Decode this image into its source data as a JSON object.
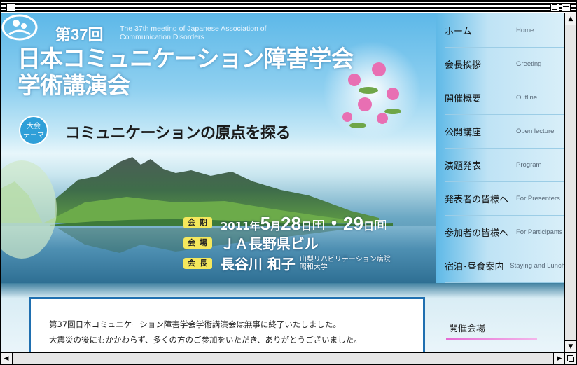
{
  "hero": {
    "meeting_number": "第37回",
    "subtitle_line1": "The 37th meeting of Japanese Association of",
    "subtitle_line2": "Communication Disorders",
    "title_line1": "日本コミュニケーション障害学会",
    "title_line2": "学術講演会",
    "theme_badge_line1": "大会",
    "theme_badge_line2": "テーマ",
    "theme": "コミュニケーションの原点を探る",
    "date_label": "会 期",
    "date_year": "2011年",
    "date_month": "5",
    "date_month_unit": "月",
    "date_day1": "28",
    "date_day1_unit": "日",
    "date_day1_weekday": "土",
    "date_sep": "・",
    "date_day2": "29",
    "date_day2_unit": "日",
    "date_day2_weekday": "日",
    "venue_label": "会 場",
    "venue": "ＪＡ長野県ビル",
    "chair_label": "会 長",
    "chair_name": "長谷川 和子",
    "chair_aff1": "山梨リハビリテーション病院",
    "chair_aff2": "昭和大学"
  },
  "nav": [
    {
      "ja": "ホーム",
      "en": "Home"
    },
    {
      "ja": "会長挨拶",
      "en": "Greeting"
    },
    {
      "ja": "開催概要",
      "en": "Outline"
    },
    {
      "ja": "公開講座",
      "en": "Open lecture"
    },
    {
      "ja": "演題発表",
      "en": "Program"
    },
    {
      "ja": "発表者の皆様へ",
      "en": "For Presenters"
    },
    {
      "ja": "参加者の皆様へ",
      "en": "For Participants"
    },
    {
      "ja": "宿泊･昼食案内",
      "en": "Staying and Lunch"
    }
  ],
  "notice": {
    "line1": "第37回日本コミュニケーション障害学会学術講演会は無事に終了いたしました。",
    "line2": "大震災の後にもかかわらず、多くの方のご参加をいただき、ありがとうございました。"
  },
  "sidebar": {
    "heading": "開催会場"
  },
  "icons": {
    "close": "close-box-icon",
    "zoom": "zoom-box-icon",
    "collapse": "collapse-box-icon",
    "scroll_up": "arrow-up-icon",
    "scroll_down": "arrow-down-icon",
    "scroll_left": "arrow-left-icon",
    "scroll_right": "arrow-right-icon",
    "logo": "association-logo-icon"
  },
  "colors": {
    "accent_blue": "#1f6fb0",
    "label_yellow": "#f5e85c",
    "sky": "#5db8e8",
    "pink_line": "#e56ad2"
  }
}
